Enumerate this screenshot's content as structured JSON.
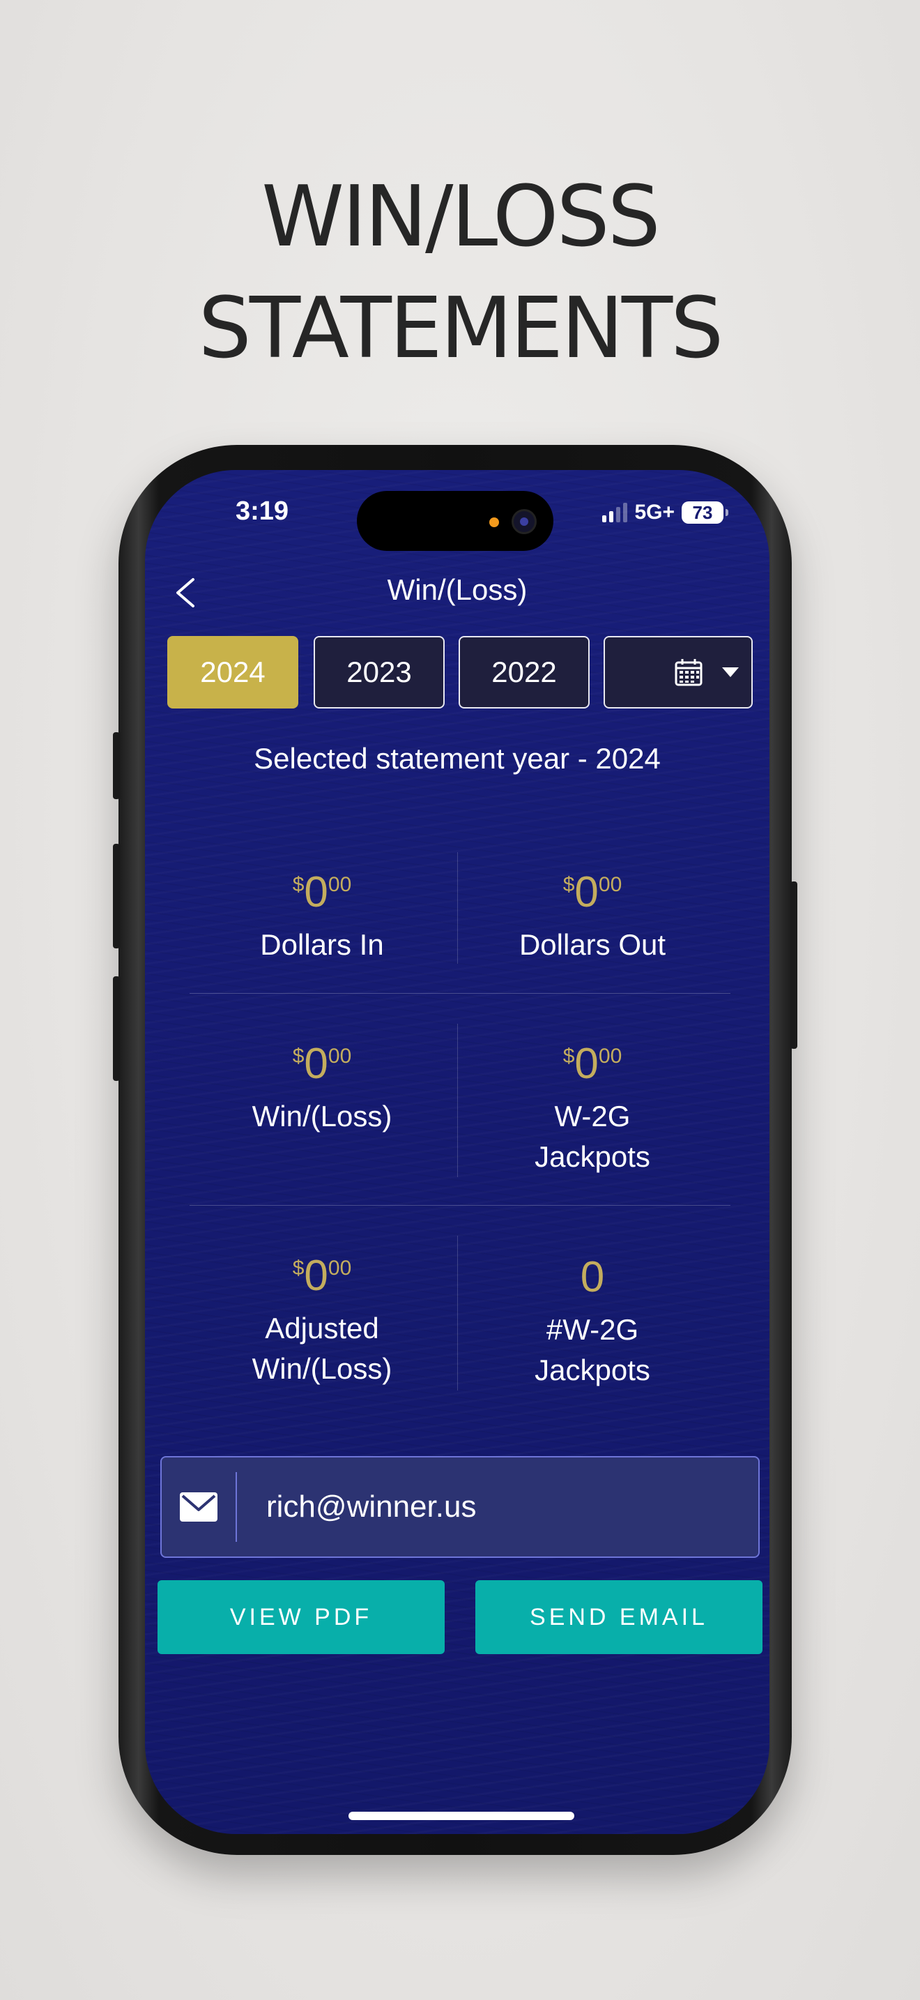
{
  "headline": {
    "line1": "WIN/LOSS",
    "line2": "STATEMENTS"
  },
  "status_bar": {
    "time": "3:19",
    "network": "5G+",
    "battery": "73"
  },
  "nav": {
    "title": "Win/(Loss)",
    "back_icon": "chevron-left-icon"
  },
  "year_tabs": {
    "items": [
      {
        "label": "2024",
        "active": true
      },
      {
        "label": "2023",
        "active": false
      },
      {
        "label": "2022",
        "active": false
      }
    ],
    "calendar_icon": "calendar-icon",
    "dropdown_icon": "caret-down-icon"
  },
  "selected_year_text": "Selected statement year - 2024",
  "stats": {
    "dollars_in": {
      "symbol": "$",
      "whole": "0",
      "cents": "00",
      "label": "Dollars In"
    },
    "dollars_out": {
      "symbol": "$",
      "whole": "0",
      "cents": "00",
      "label": "Dollars Out"
    },
    "win_loss": {
      "symbol": "$",
      "whole": "0",
      "cents": "00",
      "label": "Win/(Loss)"
    },
    "w2g_jackpots": {
      "symbol": "$",
      "whole": "0",
      "cents": "00",
      "label_line1": "W-2G",
      "label_line2": "Jackpots"
    },
    "adjusted_win_loss": {
      "symbol": "$",
      "whole": "0",
      "cents": "00",
      "label_line1": "Adjusted",
      "label_line2": "Win/(Loss)"
    },
    "w2g_count": {
      "value": "0",
      "label_line1": "#W-2G",
      "label_line2": "Jackpots"
    }
  },
  "email": {
    "value": "rich@winner.us",
    "icon": "envelope-icon"
  },
  "buttons": {
    "view_pdf": "VIEW PDF",
    "send_email": "SEND EMAIL"
  },
  "colors": {
    "background": "#151a70",
    "accent_gold": "#c8b24a",
    "value_gold": "#c4ad5e",
    "teal": "#08afaa",
    "email_bg": "#2c3372"
  }
}
